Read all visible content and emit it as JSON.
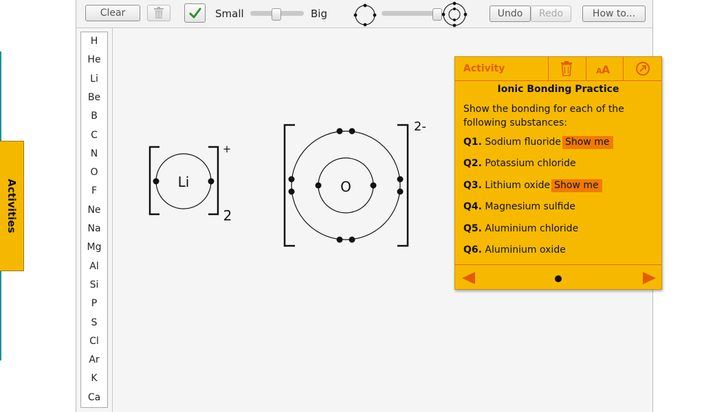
{
  "activities_tab": {
    "label": "Activities"
  },
  "toolbar": {
    "clear_label": "Clear",
    "small_label": "Small",
    "big_label": "Big",
    "undo_label": "Undo",
    "redo_label": "Redo",
    "howto_label": "How to..."
  },
  "elements": [
    "H",
    "He",
    "Li",
    "Be",
    "B",
    "C",
    "N",
    "O",
    "F",
    "Ne",
    "Na",
    "Mg",
    "Al",
    "Si",
    "P",
    "S",
    "Cl",
    "Ar",
    "K",
    "Ca"
  ],
  "diagrams": {
    "lithium": {
      "symbol": "Li",
      "charge": "+",
      "count": "2"
    },
    "oxygen": {
      "symbol": "O",
      "charge": "2-"
    }
  },
  "panel": {
    "title": "Activity",
    "practice_title": "Ionic Bonding Practice",
    "instructions": "Show the bonding for each of the following substances:",
    "questions": [
      {
        "num": "Q1.",
        "text": "Sodium fluoride",
        "show_me": "Show me"
      },
      {
        "num": "Q2.",
        "text": "Potassium chloride",
        "show_me": ""
      },
      {
        "num": "Q3.",
        "text": "Lithium oxide",
        "show_me": "Show me"
      },
      {
        "num": "Q4.",
        "text": "Magnesium sulfide",
        "show_me": ""
      },
      {
        "num": "Q5.",
        "text": "Aluminium chloride",
        "show_me": ""
      },
      {
        "num": "Q6.",
        "text": "Aluminium oxide",
        "show_me": ""
      }
    ]
  },
  "colors": {
    "panel": "#f7b900",
    "accent": "#e35d00",
    "show_me": "#f27a00",
    "teal": "#1b8fa3"
  }
}
